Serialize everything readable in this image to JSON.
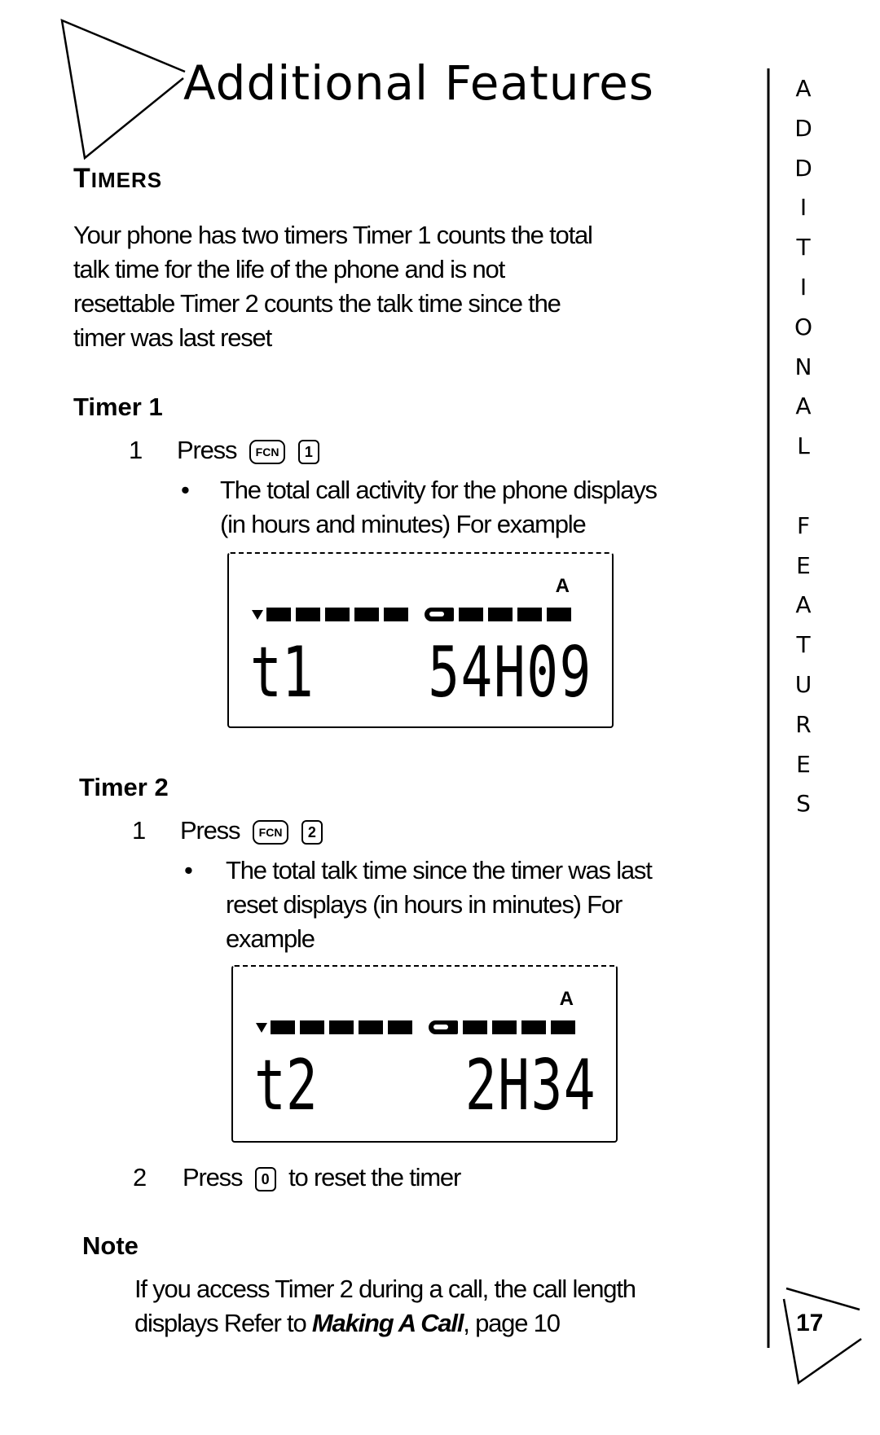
{
  "page": {
    "title": "Additional Features",
    "section_first": "T",
    "section_rest": "IMERS",
    "intro": [
      "Your phone has two timers  Timer 1 counts the total",
      "talk time for the life of the phone and is not",
      "resettable  Timer 2 counts the talk time since the",
      "timer was last reset"
    ],
    "timer1": {
      "heading": "Timer 1",
      "step1_num": "1",
      "step1_press": "Press",
      "key_fcn": "FCN",
      "key_1": "1",
      "bullet": [
        "The total call activity for the phone displays",
        "(in hours and minutes)  For example"
      ],
      "lcd": {
        "indicator": "A",
        "label": "t1",
        "value": "54H09"
      }
    },
    "timer2": {
      "heading": "Timer 2",
      "step1_num": "1",
      "step1_press": "Press",
      "key_fcn": "FCN",
      "key_2": "2",
      "bullet": [
        "The total talk time since the timer was last",
        "reset displays (in hours in minutes)  For",
        "example"
      ],
      "lcd": {
        "indicator": "A",
        "label": "t2",
        "value": "2H34"
      },
      "step2_num": "2",
      "step2_press": "Press",
      "key_0": "0",
      "step2_text": "to reset the timer"
    },
    "note": {
      "heading": "Note",
      "line1": "If you access Timer 2 during a call, the call length",
      "line2_pre": "displays  Refer to ",
      "line2_link": "Making A Call",
      "line2_post": ", page 10"
    },
    "side_tab": [
      "A",
      "D",
      "D",
      "I",
      "T",
      "I",
      "O",
      "N",
      "A",
      "L",
      "",
      "F",
      "E",
      "A",
      "T",
      "U",
      "R",
      "E",
      "S"
    ],
    "page_number": "17"
  }
}
